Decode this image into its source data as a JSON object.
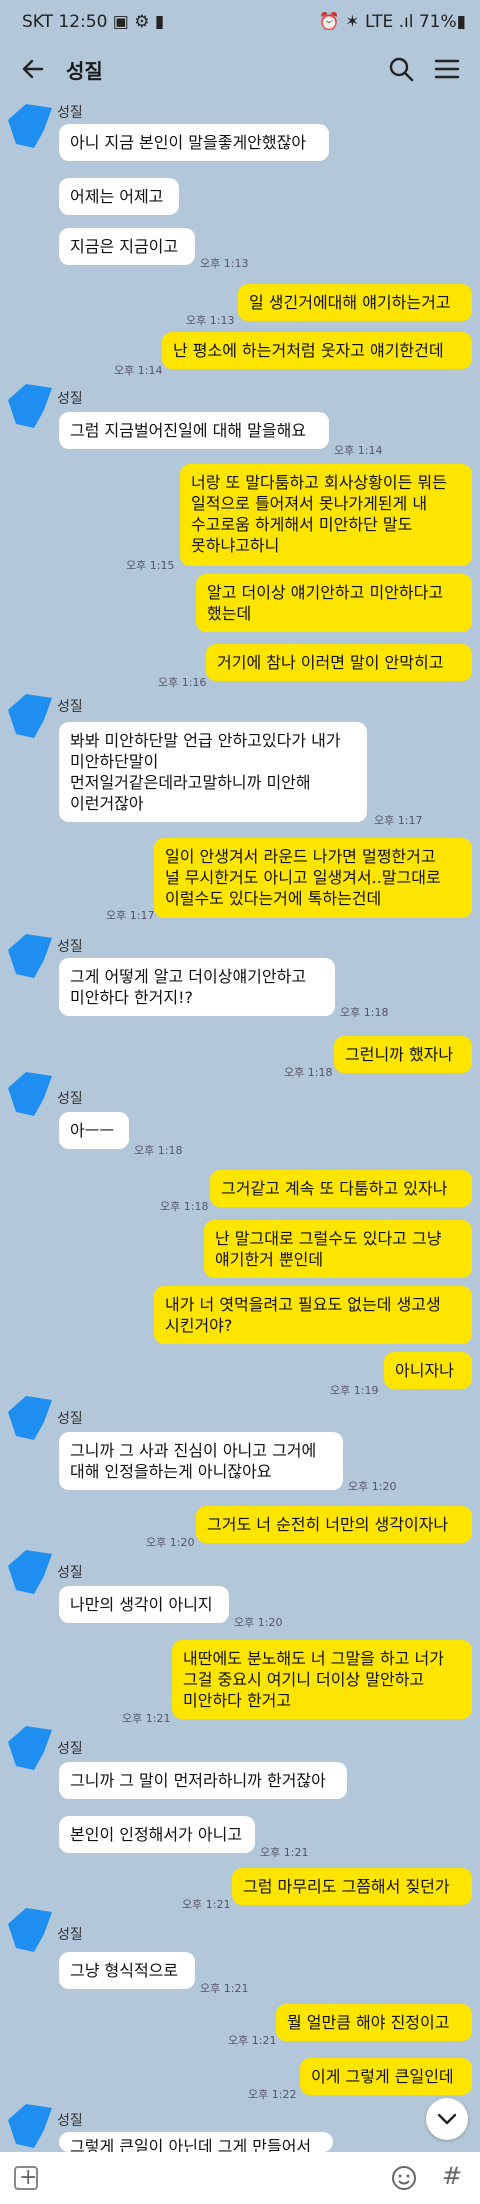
{
  "status_bar": {
    "left": "SKT 12:50 ▣ ⚙ ▮",
    "right": "⏰ ✶ LTE .ıl 71%▮"
  },
  "header": {
    "title": "성질"
  },
  "colors": {
    "background": "#b2c7d9",
    "outgoing": "#fee500",
    "incoming": "#ffffff"
  },
  "messages": [
    {
      "name": "성질"
    },
    {
      "text": "아니 지금 본인이 말을좋게안했잖아"
    },
    {
      "text": "어제는 어제고"
    },
    {
      "text": "지금은 지금이고",
      "time": "오후 1:13"
    },
    {
      "text": "일 생긴거에대해 얘기하는거고",
      "time": "오후 1:13"
    },
    {
      "text": "난 평소에 하는거처럼 웃자고 얘기한건데",
      "time": "오후 1:14"
    },
    {
      "name": "성질"
    },
    {
      "text": "그럼 지금벌어진일에 대해 말을해요",
      "time": "오후 1:14"
    },
    {
      "text": "너랑 또 말다툼하고 회사상황이든 뭐든\n일적으로 틀어져서 못나가게된게 내\n수고로움 하게해서 미안하단 말도\n못하냐고하니",
      "time": "오후 1:15"
    },
    {
      "text": "알고 더이상 얘기안하고 미안하다고\n했는데"
    },
    {
      "text": "거기에 참나 이러면 말이 안막히고",
      "time": "오후 1:16"
    },
    {
      "name": "성질"
    },
    {
      "text": "봐봐 미안하단말 언급 안하고있다가 내가\n미안하단말이\n먼저일거같은데라고말하니까 미안해\n이런거잖아",
      "time": "오후 1:17"
    },
    {
      "text": "일이 안생겨서 라운드 나가면 멀쩡한거고\n널 무시한거도 아니고 일생겨서..말그대로\n이럴수도 있다는거에 톡하는건데",
      "time": "오후 1:17"
    },
    {
      "name": "성질"
    },
    {
      "text": "그게 어떻게 알고 더이상얘기안하고\n미안하다 한거지!?",
      "time": "오후 1:18"
    },
    {
      "text": "그런니까 했자나",
      "time": "오후 1:18"
    },
    {
      "name": "성질"
    },
    {
      "text": "아ㅡㅡ",
      "time": "오후 1:18"
    },
    {
      "text": "그거같고 계속 또 다툼하고 있자나",
      "time": "오후 1:18"
    },
    {
      "text": "난 말그대로 그럴수도 있다고 그냥\n얘기한거 뿐인데"
    },
    {
      "text": "내가 너 엿먹을려고 필요도 없는데 생고생\n시킨거야?"
    },
    {
      "text": "아니자나",
      "time": "오후 1:19"
    },
    {
      "name": "성질"
    },
    {
      "text": "그니까 그 사과 진심이 아니고 그거에\n대해 인정을하는게 아니잖아요",
      "time": "오후 1:20"
    },
    {
      "text": "그거도 너 순전히 너만의 생각이자나",
      "time": "오후 1:20"
    },
    {
      "name": "성질"
    },
    {
      "text": "나만의 생각이 아니지",
      "time": "오후 1:20"
    },
    {
      "text": "내딴에도 분노해도 너 그말을 하고 너가\n그걸 중요시 여기니 더이상 말안하고\n미안하다 한거고",
      "time": "오후 1:21"
    },
    {
      "name": "성질"
    },
    {
      "text": "그니까 그 말이 먼저라하니까 한거잖아"
    },
    {
      "text": "본인이 인정해서가 아니고",
      "time": "오후 1:21"
    },
    {
      "text": "그럼 마무리도 그쯤해서 짖던가",
      "time": "오후 1:21"
    },
    {
      "name": "성질"
    },
    {
      "text": "그냥 형식적으로",
      "time": "오후 1:21"
    },
    {
      "text": "뭘 얼만큼 해야 진정이고",
      "time": "오후 1:21"
    },
    {
      "text": "이게 그렇게 큰일인데",
      "time": "오후 1:22"
    },
    {
      "name": "성질"
    },
    {
      "text": "그렇게 큰일이 아닌데 그게 만들어서"
    }
  ]
}
